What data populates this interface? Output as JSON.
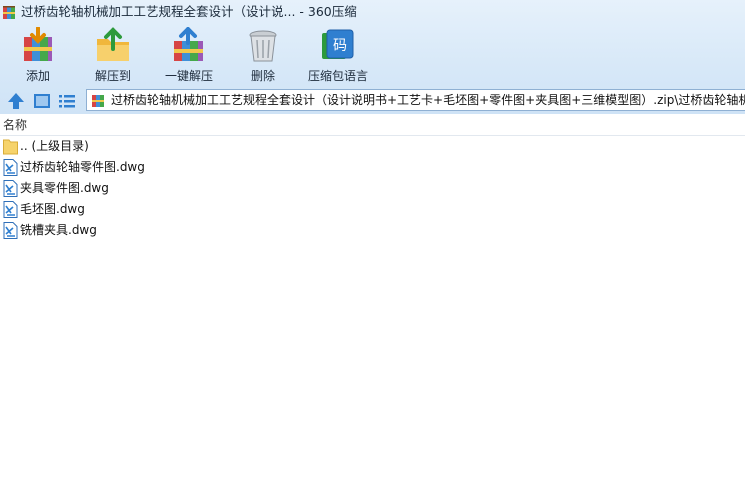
{
  "window": {
    "title": "过桥齿轮轴机械加工工艺规程全套设计（设计说... - 360压缩",
    "app_icon": "archive-books-icon"
  },
  "toolbar": {
    "items": [
      {
        "label": "添加",
        "icon": "add-icon"
      },
      {
        "label": "解压到",
        "icon": "extract-to-folder-icon"
      },
      {
        "label": "一键解压",
        "icon": "one-click-extract-icon"
      },
      {
        "label": "删除",
        "icon": "trash-bin-icon"
      },
      {
        "label": "压缩包语言",
        "icon": "archive-language-icon"
      }
    ],
    "language_glyph": "码"
  },
  "navbar": {
    "up_icon": "up-arrow-icon",
    "view_icon": "thumbnail-view-icon",
    "list_icon": "list-view-icon",
    "address": "过桥齿轮轴机械加工工艺规程全套设计（设计说明书+工艺卡+毛坯图+零件图+夹具图+三维模型图）.zip\\过桥齿轮轴机"
  },
  "file_list": {
    "column_name": "名称",
    "rows": [
      {
        "name": ".. (上级目录)",
        "type": "folder"
      },
      {
        "name": "过桥齿轮轴零件图.dwg",
        "type": "dwg"
      },
      {
        "name": "夹具零件图.dwg",
        "type": "dwg"
      },
      {
        "name": "毛坯图.dwg",
        "type": "dwg"
      },
      {
        "name": "铣槽夹具.dwg",
        "type": "dwg"
      }
    ]
  },
  "colors": {
    "chrome_bg": "#d7e8f8",
    "accent_blue": "#2f7fd0",
    "folder_yellow": "#f6d36b"
  }
}
